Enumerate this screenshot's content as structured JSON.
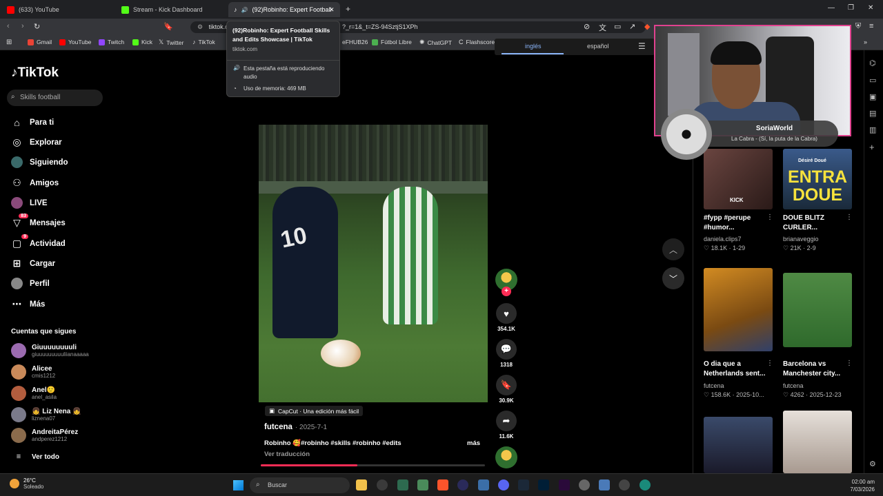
{
  "browser": {
    "tabs": [
      {
        "label": "(633) YouTube",
        "color": "#ff0000"
      },
      {
        "label": "Stream - Kick Dashboard",
        "color": "#53fc18"
      },
      {
        "label": "(92)Robinho: Expert Football",
        "color": "#000000"
      }
    ],
    "url": "tiktok.com",
    "url_tail": "?_r=1&_t=ZS-94SztjS1XPh",
    "bookmarks": [
      {
        "label": "Gmail",
        "color": "#ea4335"
      },
      {
        "label": "YouTube",
        "color": "#ff0000"
      },
      {
        "label": "Twitch",
        "color": "#9146ff"
      },
      {
        "label": "Kick",
        "color": "#53fc18"
      },
      {
        "label": "Twitter",
        "color": "#ffffff"
      },
      {
        "label": "TikTok",
        "color": "#ffffff"
      },
      {
        "label": "eFHUB26",
        "color": "#2b8cff"
      },
      {
        "label": "Fútbol Libre",
        "color": "#4caf50"
      },
      {
        "label": "ChatGPT",
        "color": "#cfcfcf"
      },
      {
        "label": "Flashscore",
        "color": "#cfcfcf"
      }
    ]
  },
  "tooltip": {
    "title": "(92)Robinho: Expert Football Skills and Edits Showcase | TikTok",
    "domain": "tiktok.com",
    "audio": "Esta pestaña está reproduciendo audio",
    "memory": "Uso de memoria: 469 MB"
  },
  "translate": {
    "from": "inglés",
    "to": "español"
  },
  "tiktok": {
    "logo": "TikTok",
    "search_placeholder": "Skills football",
    "nav": [
      {
        "label": "Para ti",
        "icon": "home-icon"
      },
      {
        "label": "Explorar",
        "icon": "compass-icon"
      },
      {
        "label": "Siguiendo",
        "icon": "following-icon"
      },
      {
        "label": "Amigos",
        "icon": "friends-icon"
      },
      {
        "label": "LIVE",
        "icon": "live-icon"
      },
      {
        "label": "Mensajes",
        "icon": "messages-icon",
        "badge": "83"
      },
      {
        "label": "Actividad",
        "icon": "activity-icon",
        "badge": "9"
      },
      {
        "label": "Cargar",
        "icon": "upload-icon"
      },
      {
        "label": "Perfil",
        "icon": "profile-icon"
      },
      {
        "label": "Más",
        "icon": "more-icon"
      }
    ],
    "following_title": "Cuentas que sigues",
    "following": [
      {
        "name": "Giuuuuuuuuli",
        "handle": "giuuuuuuuuuliianaaaaa",
        "color": "#9b6bb0"
      },
      {
        "name": "Alicee",
        "handle": "cmis1212",
        "color": "#c98a5a"
      },
      {
        "name": "Anel🙂",
        "handle": "anel_asila",
        "color": "#b35d3e"
      },
      {
        "name": "👧 Liz Nena 👧",
        "handle": "liznena07",
        "color": "#7a7a8a"
      },
      {
        "name": "AndreitaPérez",
        "handle": "andperez1212",
        "color": "#8a6b4c"
      }
    ],
    "see_all": "Ver todo"
  },
  "video": {
    "capcut": "CapCut · Una edición más fácil",
    "author": "futcena",
    "date": "· 2025-7-1",
    "description": "Robinho 🥰#robinho #skills #robinho #edits",
    "more": "más",
    "translate": "Ver traducción",
    "progress": 0.43,
    "likes": "354.1K",
    "comments": "1318",
    "saves": "30.9K",
    "shares": "11.6K"
  },
  "webcam": {
    "artist": "SoriaWorld",
    "track": "La Cabra - (Sí, la puta de la Cabra)"
  },
  "grid": [
    {
      "title": "#fypp #perupe #humor...",
      "author": "daniela.clips7",
      "views": "18.1K",
      "date": "1-29",
      "thumb": "#5a3e3a"
    },
    {
      "title": "DOUE BLITZ CURLER...",
      "author": "brianaveggio",
      "views": "21K",
      "date": "2-9",
      "thumb": "#2e4a6a",
      "overlay": "Désiré Doué",
      "big": "ENTRA DOUE"
    },
    {
      "title": "O dia que a Netherlands sent...",
      "author": "futcena",
      "views": "158.6K",
      "date": "2025-10...",
      "thumb": "#c27a1e"
    },
    {
      "title": "Barcelona vs Manchester city...",
      "author": "futcena",
      "views": "4262",
      "date": "2025-12-23",
      "thumb": "#3f7a3a"
    },
    {
      "title": "",
      "author": "",
      "views": "",
      "date": "",
      "thumb": "#2c3a55"
    },
    {
      "title": "",
      "author": "",
      "views": "",
      "date": "",
      "thumb": "#cfc6c0"
    }
  ],
  "taskbar": {
    "temp": "26°C",
    "weather": "Soleado",
    "search": "Buscar",
    "time": "02:00 am",
    "date": "7/03/2026"
  }
}
